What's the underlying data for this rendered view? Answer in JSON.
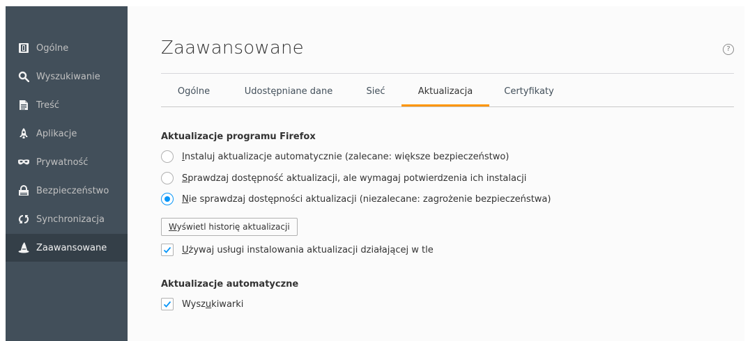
{
  "sidebar": {
    "items": [
      {
        "label": "Ogólne",
        "icon": "general-icon"
      },
      {
        "label": "Wyszukiwanie",
        "icon": "search-icon"
      },
      {
        "label": "Treść",
        "icon": "document-icon"
      },
      {
        "label": "Aplikacje",
        "icon": "rocket-icon"
      },
      {
        "label": "Prywatność",
        "icon": "mask-icon"
      },
      {
        "label": "Bezpieczeństwo",
        "icon": "lock-icon"
      },
      {
        "label": "Synchronizacja",
        "icon": "sync-icon"
      },
      {
        "label": "Zaawansowane",
        "icon": "wizard-hat-icon"
      }
    ],
    "selected": "Zaawansowane"
  },
  "main": {
    "title": "Zaawansowane",
    "help": "?",
    "tabs": [
      {
        "label": "Ogólne"
      },
      {
        "label": "Udostępniane dane"
      },
      {
        "label": "Sieć"
      },
      {
        "label": "Aktualizacja"
      },
      {
        "label": "Certyfikaty"
      }
    ],
    "selected_tab": "Aktualizacja"
  },
  "updates": {
    "section_title": "Aktualizacje programu Firefox",
    "options": [
      {
        "accesskey": "I",
        "rest": "nstaluj aktualizacje automatycznie (zalecane: większe bezpieczeństwo)",
        "checked": false
      },
      {
        "accesskey": "S",
        "rest": "prawdzaj dostępność aktualizacji, ale wymagaj potwierdzenia ich instalacji",
        "checked": false
      },
      {
        "accesskey": "N",
        "rest": "ie sprawdzaj dostępności aktualizacji (niezalecane: zagrożenie bezpieczeństwa)",
        "checked": true
      }
    ],
    "history_button": {
      "accesskey": "W",
      "rest": "yświetl historię aktualizacji"
    },
    "background_service": {
      "accesskey": "U",
      "rest": "żywaj usługi instalowania aktualizacji działającej w tle",
      "checked": true
    }
  },
  "auto_updates": {
    "section_title": "Aktualizacje automatyczne",
    "search_engines": {
      "before": "Wysz",
      "accesskey": "u",
      "after": "kiwarki",
      "checked": true
    }
  },
  "colors": {
    "sidebar_bg": "#424f5a",
    "sidebar_selected_bg": "#343f48",
    "accent_tab": "#ff9500",
    "radio_checked": "#0996f8"
  }
}
